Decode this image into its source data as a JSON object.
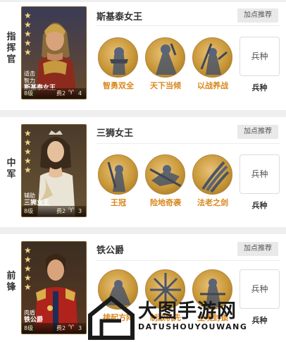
{
  "sections": [
    {
      "position": "指挥官",
      "hero_name": "斯基泰女王",
      "badge": "加点推荐",
      "card": {
        "role_line1": "适击",
        "role_line2": "智力",
        "name": "斯基泰女王",
        "level": "8级",
        "cost": "费2",
        "count": "4"
      },
      "skills": [
        "智勇双全",
        "天下当倾",
        "以战养战"
      ],
      "troop_box": "兵种",
      "troop_label": "兵种"
    },
    {
      "position": "中军",
      "hero_name": "三狮女王",
      "badge": "加点推荐",
      "card": {
        "role_line1": "辅助",
        "role_line2": "",
        "name": "三狮女王",
        "level": "8级",
        "cost": "费2",
        "count": "3"
      },
      "skills": [
        "王冠",
        "险地奇袭",
        "法老之剑"
      ],
      "troop_box": "兵种",
      "troop_label": "兵种"
    },
    {
      "position": "前锋",
      "hero_name": "铁公爵",
      "badge": "加点推荐",
      "card": {
        "role_line1": "肉盾",
        "role_line2": "",
        "name": "铁公爵",
        "level": "8级",
        "cost": "费2",
        "count": "3"
      },
      "skills": [
        "排起方阵",
        "制敌机先",
        "全境封锁"
      ],
      "troop_box": "兵种",
      "troop_label": "兵种"
    }
  ],
  "watermark": {
    "main": "大图手游网",
    "sub": "DATUSHOUYOUWANG"
  },
  "colors": {
    "skill_label": "#d8861a",
    "skill_gold": "#c99838",
    "badge_bg": "#e9e9e9",
    "gap_bg": "#efefef"
  },
  "icons": {
    "star": "star-icon",
    "pet": "pet-icon",
    "skill": "skill-emblem-icon"
  }
}
